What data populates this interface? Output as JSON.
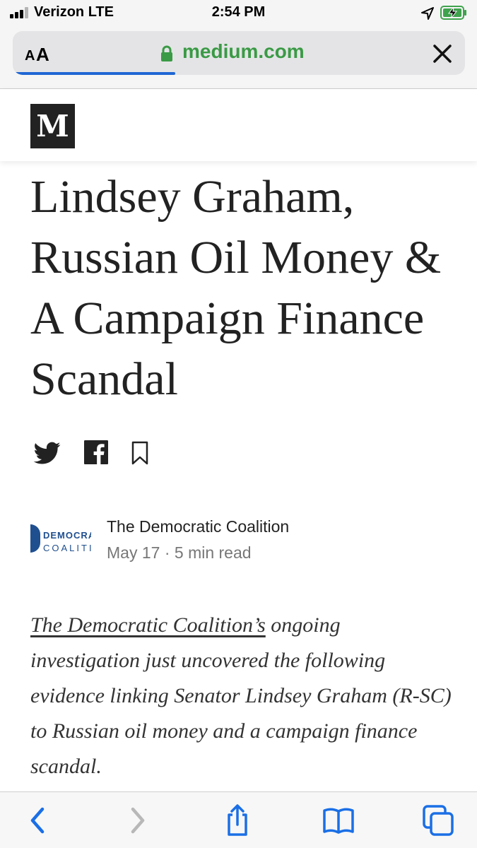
{
  "status_bar": {
    "carrier": "Verizon LTE",
    "time": "2:54 PM",
    "signal_bars_filled": 3,
    "battery_status": "charging",
    "icons": [
      "signal-icon",
      "location-icon",
      "battery-charging-icon"
    ]
  },
  "address_bar": {
    "aa_small": "A",
    "aa_large": "A",
    "url": "medium.com",
    "load_progress": 0.36,
    "icons": [
      "lock-icon",
      "close-icon"
    ]
  },
  "site": {
    "logo_letter": "M"
  },
  "article": {
    "title": "Lindsey Graham, Russian Oil Money & A Campaign Finance Scandal",
    "share_icons": [
      "twitter-icon",
      "facebook-icon",
      "bookmark-icon"
    ],
    "author": {
      "name": "The Democratic Coalition",
      "avatar_line1": "DEMOCRA",
      "avatar_line2": "COALITI",
      "date": "May 17",
      "separator": "·",
      "read_time": "5 min read"
    },
    "intro": {
      "link_text": "The Democratic Coalition’s",
      "rest": " ongoing investigation just uncovered the following evidence linking Senator Lindsey Graham (R-SC) to Russian oil money and a campaign finance scandal."
    }
  },
  "toolbar": {
    "icons": [
      "back-icon",
      "forward-icon",
      "share-icon",
      "bookmarks-icon",
      "tabs-icon"
    ]
  },
  "colors": {
    "url_green": "#3a9a45",
    "progress_blue": "#1f66d4",
    "toolbar_blue": "#1a6fe6",
    "disabled_gray": "#b8b8b8",
    "logo_bg": "#222222"
  }
}
